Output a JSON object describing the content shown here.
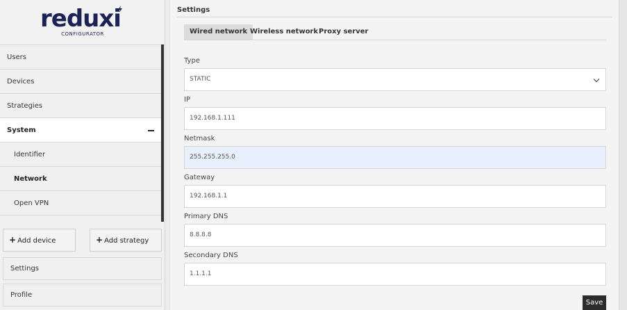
{
  "brand": {
    "name": "reduxi",
    "subtitle": "CONFIGURATOR"
  },
  "sidebar": {
    "items": [
      {
        "label": "Users"
      },
      {
        "label": "Devices"
      },
      {
        "label": "Strategies"
      },
      {
        "label": "System",
        "expanded": true
      },
      {
        "label": "Identifier"
      },
      {
        "label": "Network",
        "selected": true
      },
      {
        "label": "Open VPN"
      }
    ],
    "add_device_label": "Add device",
    "add_strategy_label": "Add strategy",
    "settings_label": "Settings",
    "profile_label": "Profile"
  },
  "main": {
    "title": "Settings",
    "tabs": [
      {
        "label": "Wired network",
        "active": true
      },
      {
        "label": "Wireless network"
      },
      {
        "label": "Proxy server"
      }
    ],
    "fields": {
      "type": {
        "label": "Type",
        "value": "STATIC"
      },
      "ip": {
        "label": "IP",
        "value": "192.168.1.111"
      },
      "netmask": {
        "label": "Netmask",
        "value": "255.255.255.0"
      },
      "gateway": {
        "label": "Gateway",
        "value": "192.168.1.1"
      },
      "primary_dns": {
        "label": "Primary DNS",
        "value": "8.8.8.8"
      },
      "secondary_dns": {
        "label": "Secondary DNS",
        "value": "1.1.1.1"
      }
    },
    "save_label": "Save"
  },
  "colors": {
    "brand": "#1c2255",
    "focus_field": "#e8f0fe",
    "save_button": "#2b2b2b"
  },
  "icons": {
    "collapse": "minus-icon",
    "select": "chevron-down-icon",
    "add": "plus-icon"
  }
}
